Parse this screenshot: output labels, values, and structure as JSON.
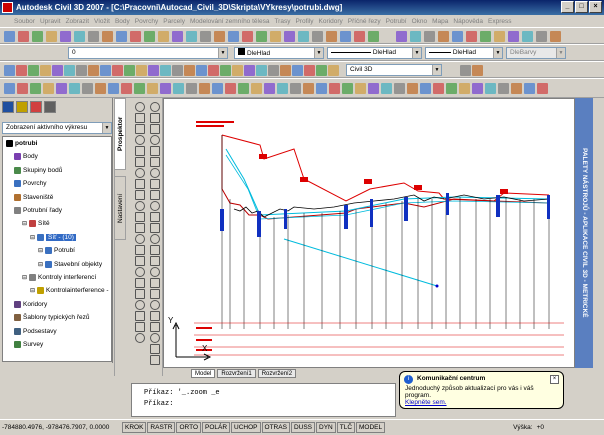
{
  "window": {
    "title": "Autodesk Civil 3D 2007 - [C:\\Pracovni\\Autocad_Civil_3D\\Skripta\\VYkresy\\potrubi.dwg]"
  },
  "menu": [
    "Soubor",
    "Upravit",
    "Zobrazit",
    "Vložit",
    "Body",
    "Povrchy",
    "Parcely",
    "Modelování zemního tělesa",
    "Trasy",
    "Profily",
    "Koridory",
    "Příčné řezy",
    "Potrubí",
    "Okno",
    "Mapa",
    "Nápověda",
    "Express"
  ],
  "toolbar": {
    "layer_combo": "0",
    "color_combo": "DleHlad",
    "linetype_combo": "DleHlad",
    "lineweight_combo": "DleHlad",
    "plotstyle_combo": "DleBarvy",
    "workspace_combo": "Civil 3D"
  },
  "prospector": {
    "view_combo": "Zobrazení aktivního výkresu",
    "tab_prospector": "Prospektor",
    "tab_settings": "Nastavení",
    "tree": [
      {
        "label": "potrubi",
        "level": 0,
        "bold": true,
        "color": "#000000"
      },
      {
        "label": "Body",
        "level": 1,
        "color": "#7a3fb0"
      },
      {
        "label": "Skupiny bodů",
        "level": 1,
        "color": "#4a8a4a"
      },
      {
        "label": "Povrchy",
        "level": 1,
        "color": "#3a70c0"
      },
      {
        "label": "Staveniště",
        "level": 1,
        "color": "#b07030"
      },
      {
        "label": "Potrubní řady",
        "level": 1,
        "color": "#808080"
      },
      {
        "label": "Sítě",
        "level": 2,
        "color": "#c04040"
      },
      {
        "label": "Síť - (10)",
        "level": 3,
        "color": "#3a70c0",
        "selected": true
      },
      {
        "label": "Potrubí",
        "level": 4,
        "color": "#3a70c0"
      },
      {
        "label": "Stavební objekty",
        "level": 4,
        "color": "#3a70c0"
      },
      {
        "label": "Kontroly interferencí",
        "level": 2,
        "color": "#808080"
      },
      {
        "label": "Kontrolainterference -",
        "level": 3,
        "color": "#c0a000"
      },
      {
        "label": "Koridory",
        "level": 1,
        "color": "#604080"
      },
      {
        "label": "Šablony typických řezů",
        "level": 1,
        "color": "#806040"
      },
      {
        "label": "Podsestavy",
        "level": 1,
        "color": "#406080"
      },
      {
        "label": "Survey",
        "level": 1,
        "color": "#408040"
      }
    ]
  },
  "right_palette": "PALETY NÁSTROJŮ - APLIKACE CIVIL 3D - METRICKÉ",
  "layout_tabs": [
    "Model",
    "Rozvržení1",
    "Rozvržení2"
  ],
  "command_line": {
    "line1": "Příkaz: '_.zoom _e",
    "line2": "Příkaz:"
  },
  "status": {
    "coords": "-784880.4976, -978476.7907, 0.0000",
    "buttons": [
      "KROK",
      "RASTR",
      "ORTO",
      "POLÁR",
      "UCHOP",
      "OTRAS",
      "DUSS",
      "DYN",
      "TLČ",
      "MODEL"
    ],
    "elevation_label": "Výška:",
    "elevation_value": "+0"
  },
  "balloon": {
    "title": "Komunikační centrum",
    "body": "Jednoduchý způsob aktualizací pro vás i váš program.",
    "link": "Klepněte sem."
  },
  "canvas": {
    "axis_y": "Y",
    "axis_x": "X"
  }
}
